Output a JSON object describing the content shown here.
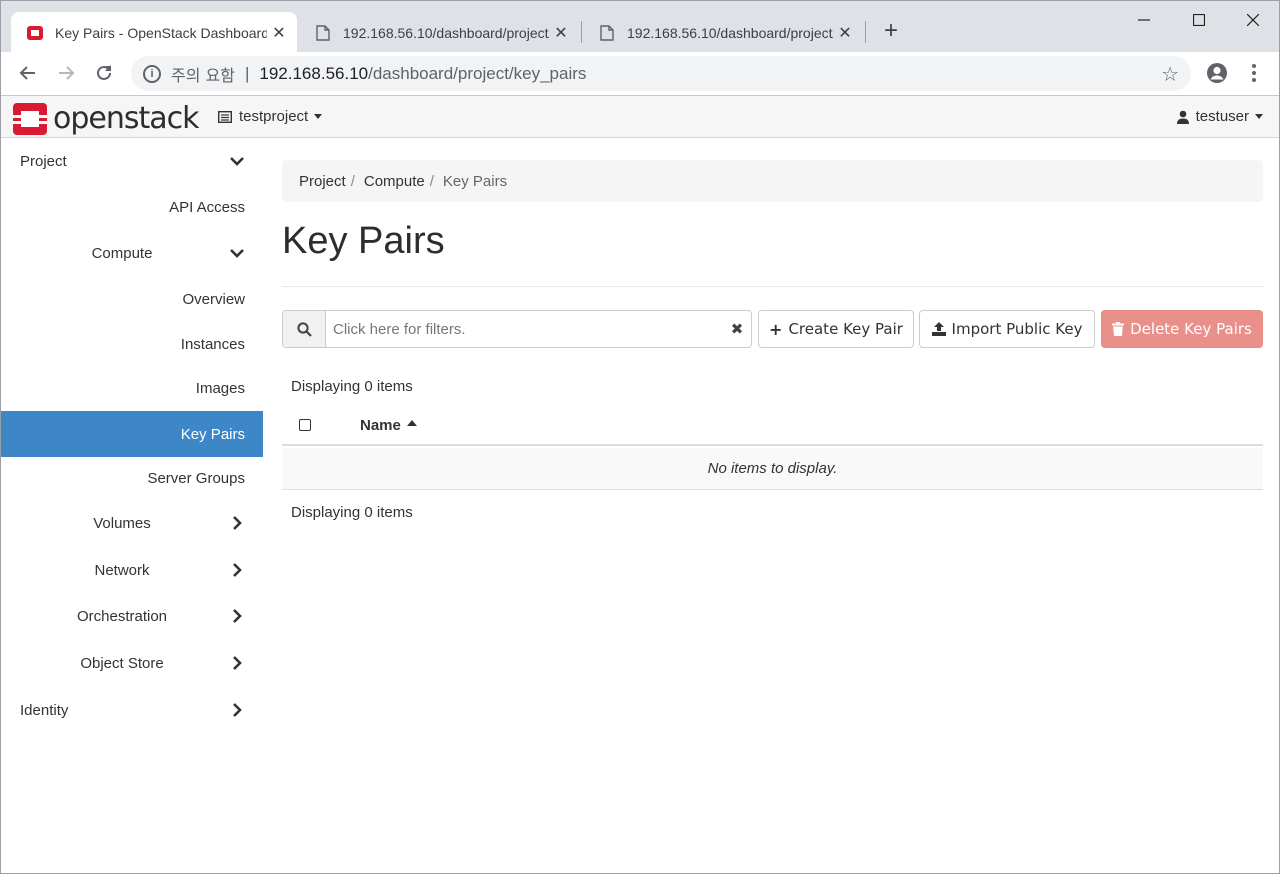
{
  "browser": {
    "tabs": [
      {
        "title": "Key Pairs - OpenStack Dashboard",
        "active": true
      },
      {
        "title": "192.168.56.10/dashboard/project/",
        "active": false
      },
      {
        "title": "192.168.56.10/dashboard/project/",
        "active": false
      }
    ],
    "address": {
      "security_label": "주의 요함",
      "host": "192.168.56.10",
      "path": "/dashboard/project/key_pairs"
    }
  },
  "topnav": {
    "brand": "openstack",
    "project": "testproject",
    "user": "testuser"
  },
  "sidebar": {
    "items": [
      {
        "label": "Project",
        "chevron": "down"
      },
      {
        "label": "API Access"
      },
      {
        "label": "Compute",
        "chevron": "down"
      },
      {
        "label": "Overview"
      },
      {
        "label": "Instances"
      },
      {
        "label": "Images"
      },
      {
        "label": "Key Pairs",
        "active": true
      },
      {
        "label": "Server Groups"
      },
      {
        "label": "Volumes",
        "chevron": "right"
      },
      {
        "label": "Network",
        "chevron": "right"
      },
      {
        "label": "Orchestration",
        "chevron": "right"
      },
      {
        "label": "Object Store",
        "chevron": "right"
      },
      {
        "label": "Identity",
        "chevron": "right"
      }
    ]
  },
  "breadcrumb": [
    "Project",
    "Compute",
    "Key Pairs"
  ],
  "page_title": "Key Pairs",
  "filter": {
    "placeholder": "Click here for filters."
  },
  "actions": {
    "create": "Create Key Pair",
    "import": "Import Public Key",
    "delete": "Delete Key Pairs"
  },
  "table": {
    "count_text": "Displaying 0 items",
    "columns": [
      "Name"
    ],
    "empty_text": "No items to display."
  },
  "colors": {
    "active_nav": "#3d87c9",
    "danger_disabled": "#e9908a",
    "brand_red": "#da1a32"
  }
}
